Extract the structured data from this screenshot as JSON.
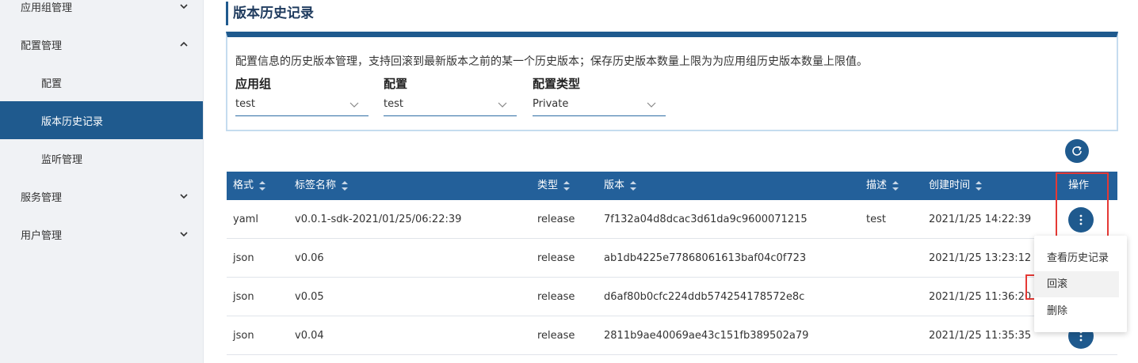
{
  "sidebar": {
    "items": [
      {
        "label": "应用组管理",
        "expanded": false
      },
      {
        "label": "配置管理",
        "expanded": true
      },
      {
        "label": "配置",
        "sub": true
      },
      {
        "label": "版本历史记录",
        "sub": true,
        "active": true
      },
      {
        "label": "监听管理",
        "sub": true
      },
      {
        "label": "服务管理",
        "expanded": false
      },
      {
        "label": "用户管理",
        "expanded": false
      }
    ]
  },
  "page": {
    "title": "版本历史记录",
    "description": "配置信息的历史版本管理，支持回滚到最新版本之前的某一个历史版本；保存历史版本数量上限为为应用组历史版本数量上限值。"
  },
  "filters": {
    "app_group": {
      "label": "应用组",
      "value": "test"
    },
    "config": {
      "label": "配置",
      "value": "test"
    },
    "config_type": {
      "label": "配置类型",
      "value": "Private"
    }
  },
  "table": {
    "headers": {
      "format": "格式",
      "tag": "标签名称",
      "type": "类型",
      "version": "版本",
      "desc": "描述",
      "created": "创建时间",
      "action": "操作"
    },
    "rows": [
      {
        "format": "yaml",
        "tag": "v0.0.1-sdk-2021/01/25/06:22:39",
        "type": "release",
        "version": "7f132a04d8dcac3d61da9c9600071215",
        "desc": "test",
        "created": "2021/1/25 14:22:39"
      },
      {
        "format": "json",
        "tag": "v0.06",
        "type": "release",
        "version": "ab1db4225e77868061613baf04c0f723",
        "desc": "",
        "created": "2021/1/25 13:23:12"
      },
      {
        "format": "json",
        "tag": "v0.05",
        "type": "release",
        "version": "d6af80b0cfc224ddb574254178572e8c",
        "desc": "",
        "created": "2021/1/25 11:36:20"
      },
      {
        "format": "json",
        "tag": "v0.04",
        "type": "release",
        "version": "2811b9ae40069ae43c151fb389502a79",
        "desc": "",
        "created": "2021/1/25 11:35:35"
      }
    ]
  },
  "menu": {
    "items": [
      "查看历史记录",
      "回滚",
      "删除"
    ]
  },
  "colors": {
    "primary": "#1f5a8e",
    "header_bg": "#23609a",
    "highlight": "#e53935"
  }
}
